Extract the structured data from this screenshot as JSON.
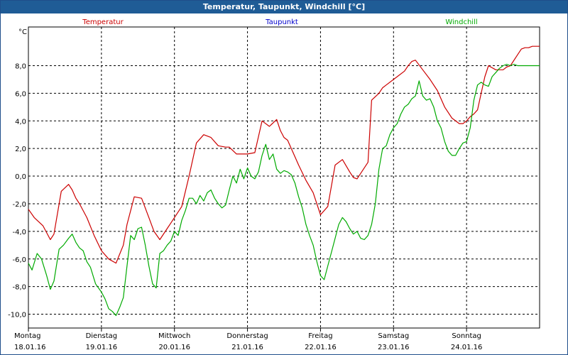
{
  "window": {
    "title": "Temperatur, Taupunkt, Windchill [°C]"
  },
  "chart_data": {
    "type": "line",
    "title": "Temperatur, Taupunkt, Windchill [°C]",
    "ylabel": "°C",
    "ylim": [
      -11,
      10.8
    ],
    "yticks": [
      -10,
      -8,
      -6,
      -4,
      -2,
      0,
      2,
      4,
      6,
      8
    ],
    "ytick_labels": [
      "-10,0",
      "-8,0",
      "-6,0",
      "-4,0",
      "-2,0",
      "0,0",
      "2,0",
      "4,0",
      "6,0",
      "8,0"
    ],
    "xlim": [
      0,
      7
    ],
    "grid": true,
    "days": [
      {
        "day": "Montag",
        "date": "18.01.16"
      },
      {
        "day": "Dienstag",
        "date": "19.01.16"
      },
      {
        "day": "Mittwoch",
        "date": "20.01.16"
      },
      {
        "day": "Donnerstag",
        "date": "21.01.16"
      },
      {
        "day": "Freitag",
        "date": "22.01.16"
      },
      {
        "day": "Samstag",
        "date": "23.01.16"
      },
      {
        "day": "Sonntag",
        "date": "24.01.16"
      }
    ],
    "legend": [
      {
        "name": "Temperatur",
        "color": "#cc0000"
      },
      {
        "name": "Taupunkt",
        "color": "#0000cc"
      },
      {
        "name": "Windchill",
        "color": "#00aa00"
      }
    ],
    "series": [
      {
        "name": "Temperatur",
        "color": "#cc0000",
        "x": [
          0,
          0.08,
          0.2,
          0.3,
          0.35,
          0.45,
          0.55,
          0.6,
          0.65,
          0.7,
          0.8,
          0.9,
          1.0,
          1.1,
          1.2,
          1.3,
          1.35,
          1.45,
          1.55,
          1.65,
          1.72,
          1.8,
          1.9,
          1.95,
          2.05,
          2.1,
          2.2,
          2.3,
          2.4,
          2.5,
          2.6,
          2.7,
          2.75,
          2.85,
          2.9,
          3.0,
          3.1,
          3.2,
          3.3,
          3.4,
          3.45,
          3.5,
          3.55,
          3.6,
          3.65,
          3.7,
          3.8,
          3.9,
          4.0,
          4.1,
          4.2,
          4.3,
          4.4,
          4.45,
          4.5,
          4.55,
          4.65,
          4.7,
          4.8,
          4.85,
          4.9,
          5.0,
          5.05,
          5.15,
          5.2,
          5.25,
          5.3,
          5.4,
          5.5,
          5.6,
          5.7,
          5.8,
          5.9,
          5.95,
          6.0,
          6.05,
          6.1,
          6.15,
          6.2,
          6.25,
          6.3,
          6.4,
          6.5,
          6.55,
          6.6,
          6.7,
          6.75,
          6.8,
          6.85,
          6.9,
          6.95,
          7.0
        ],
        "values": [
          -2.4,
          -3.0,
          -3.6,
          -4.6,
          -4.2,
          -1.1,
          -0.6,
          -1.0,
          -1.6,
          -2.0,
          -3.0,
          -4.3,
          -5.4,
          -6.0,
          -6.3,
          -5.0,
          -3.5,
          -1.5,
          -1.6,
          -3.0,
          -4.0,
          -4.6,
          -3.8,
          -3.4,
          -2.6,
          -2.2,
          0.0,
          2.4,
          3.0,
          2.8,
          2.2,
          2.1,
          2.1,
          1.6,
          1.6,
          1.6,
          1.7,
          4.0,
          3.6,
          4.1,
          3.3,
          2.8,
          2.6,
          2.0,
          1.4,
          0.8,
          -0.3,
          -1.2,
          -2.8,
          -2.2,
          0.8,
          1.2,
          0.3,
          -0.1,
          -0.2,
          0.2,
          1.0,
          5.5,
          6.0,
          6.4,
          6.6,
          7.0,
          7.2,
          7.6,
          8.0,
          8.3,
          8.4,
          7.7,
          7.0,
          6.2,
          5.0,
          4.2,
          3.8,
          3.8,
          4.0,
          4.3,
          4.5,
          4.8,
          6.0,
          7.2,
          8.0,
          7.7,
          7.7,
          7.9,
          8.0,
          8.8,
          9.2,
          9.3,
          9.3,
          9.4,
          9.4,
          9.4
        ]
      },
      {
        "name": "Windchill",
        "color": "#00aa00",
        "x": [
          0,
          0.05,
          0.12,
          0.18,
          0.25,
          0.3,
          0.35,
          0.42,
          0.48,
          0.55,
          0.6,
          0.65,
          0.7,
          0.75,
          0.8,
          0.85,
          0.92,
          1.0,
          1.05,
          1.1,
          1.15,
          1.2,
          1.25,
          1.3,
          1.35,
          1.4,
          1.45,
          1.5,
          1.55,
          1.6,
          1.65,
          1.7,
          1.75,
          1.8,
          1.85,
          1.9,
          1.95,
          2.0,
          2.05,
          2.1,
          2.15,
          2.2,
          2.25,
          2.3,
          2.35,
          2.4,
          2.45,
          2.5,
          2.55,
          2.6,
          2.65,
          2.7,
          2.75,
          2.8,
          2.85,
          2.9,
          2.95,
          3.0,
          3.05,
          3.1,
          3.15,
          3.2,
          3.25,
          3.3,
          3.35,
          3.4,
          3.45,
          3.5,
          3.55,
          3.6,
          3.65,
          3.7,
          3.75,
          3.8,
          3.85,
          3.9,
          3.95,
          4.0,
          4.05,
          4.1,
          4.15,
          4.2,
          4.25,
          4.3,
          4.35,
          4.4,
          4.45,
          4.5,
          4.55,
          4.6,
          4.65,
          4.7,
          4.75,
          4.8,
          4.85,
          4.9,
          4.95,
          5.0,
          5.05,
          5.1,
          5.15,
          5.2,
          5.25,
          5.3,
          5.35,
          5.4,
          5.45,
          5.5,
          5.55,
          5.6,
          5.65,
          5.7,
          5.75,
          5.8,
          5.85,
          5.9,
          5.95,
          6.0,
          6.05,
          6.1,
          6.15,
          6.2,
          6.25,
          6.3,
          6.35,
          6.4,
          6.45,
          6.5,
          6.55,
          6.6,
          6.65,
          6.7,
          6.75,
          6.8,
          6.85,
          6.9,
          6.95,
          7.0
        ],
        "values": [
          -6.3,
          -6.8,
          -5.6,
          -6.0,
          -7.2,
          -8.2,
          -7.6,
          -5.3,
          -5.0,
          -4.5,
          -4.2,
          -4.8,
          -5.2,
          -5.4,
          -6.2,
          -6.6,
          -7.8,
          -8.4,
          -8.9,
          -9.6,
          -9.8,
          -10.1,
          -9.5,
          -8.8,
          -6.5,
          -4.3,
          -4.6,
          -3.8,
          -3.7,
          -5.0,
          -6.5,
          -7.8,
          -8.1,
          -5.6,
          -5.4,
          -5.0,
          -4.7,
          -4.0,
          -4.3,
          -3.2,
          -2.5,
          -1.6,
          -1.6,
          -2.0,
          -1.4,
          -1.8,
          -1.2,
          -1.0,
          -1.6,
          -2.0,
          -2.3,
          -2.1,
          -1.0,
          0.0,
          -0.5,
          0.5,
          -0.2,
          0.6,
          0.0,
          -0.2,
          0.3,
          1.5,
          2.3,
          1.2,
          1.6,
          0.5,
          0.2,
          0.4,
          0.3,
          0.1,
          -0.5,
          -1.5,
          -2.3,
          -3.5,
          -4.3,
          -5.0,
          -6.2,
          -7.2,
          -7.5,
          -6.5,
          -5.5,
          -4.5,
          -3.5,
          -3.0,
          -3.3,
          -3.8,
          -4.2,
          -4.0,
          -4.5,
          -4.6,
          -4.3,
          -3.5,
          -2.0,
          0.5,
          2.0,
          2.2,
          3.0,
          3.5,
          3.8,
          4.5,
          5.0,
          5.2,
          5.6,
          5.8,
          6.9,
          5.8,
          5.5,
          5.6,
          5.0,
          4.0,
          3.5,
          2.5,
          1.8,
          1.5,
          1.5,
          2.0,
          2.4,
          2.5,
          3.5,
          5.5,
          6.6,
          6.8,
          6.6,
          6.5,
          7.2,
          7.5,
          7.8,
          8.0,
          8.1,
          8.0,
          8.1,
          8.0,
          8.0,
          8.0,
          8.0,
          8.0,
          8.0,
          8.0
        ]
      }
    ]
  }
}
